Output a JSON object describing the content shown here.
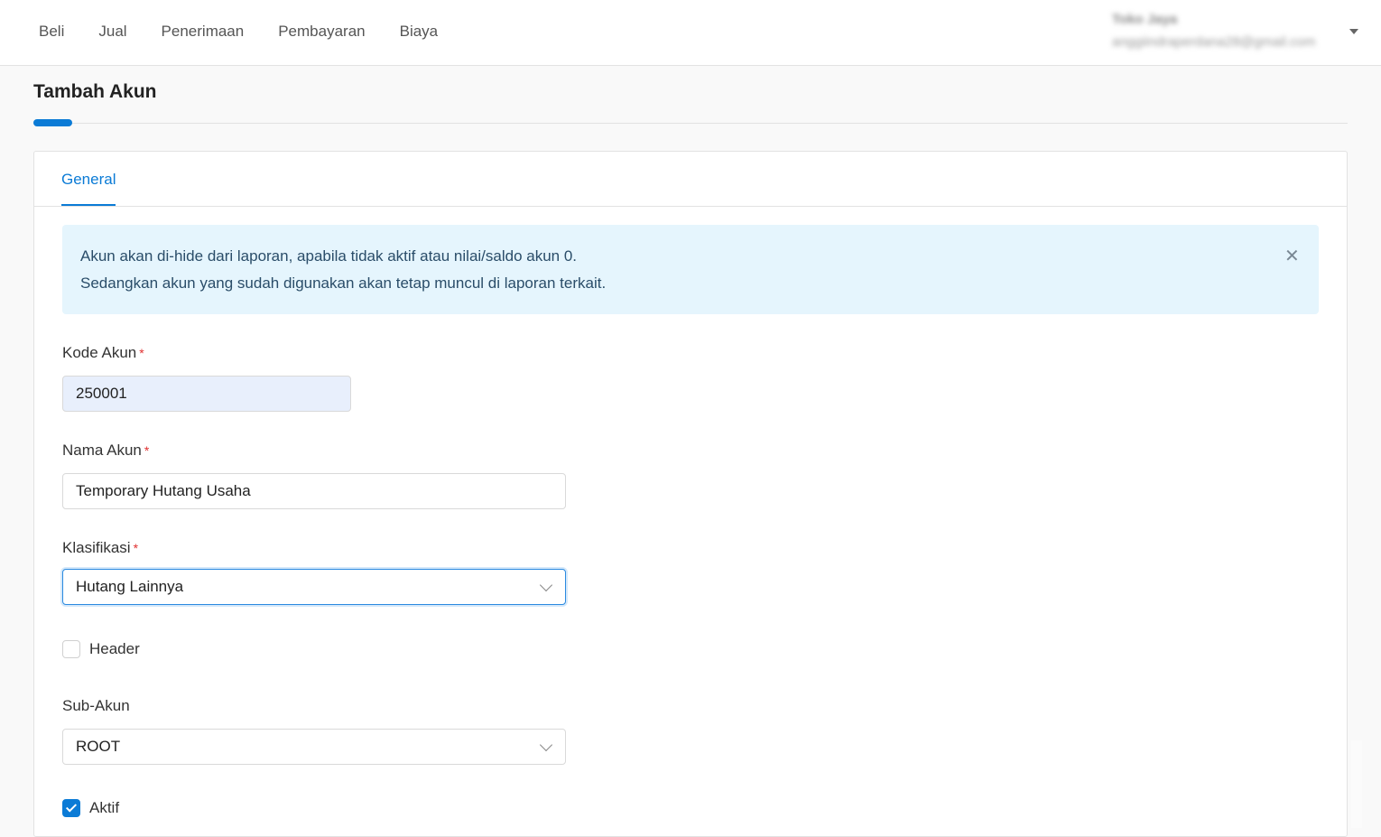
{
  "nav": {
    "items": [
      "Beli",
      "Jual",
      "Penerimaan",
      "Pembayaran",
      "Biaya"
    ]
  },
  "user": {
    "name": "Toko Jaya",
    "email": "anggiindraperdana28@gmail.com"
  },
  "page": {
    "title": "Tambah Akun"
  },
  "tabs": {
    "general": "General"
  },
  "alert": {
    "line1": "Akun akan di-hide dari laporan, apabila tidak aktif atau nilai/saldo akun 0.",
    "line2": "Sedangkan akun yang sudah digunakan akan tetap muncul di laporan terkait.",
    "close_icon": "close-icon"
  },
  "form": {
    "required_mark": "*",
    "kode_akun": {
      "label": "Kode Akun",
      "value": "250001"
    },
    "nama_akun": {
      "label": "Nama Akun",
      "value": "Temporary Hutang Usaha"
    },
    "klasifikasi": {
      "label": "Klasifikasi",
      "value": "Hutang Lainnya"
    },
    "header": {
      "label": "Header",
      "checked": false
    },
    "sub_akun": {
      "label": "Sub-Akun",
      "value": "ROOT"
    },
    "aktif": {
      "label": "Aktif",
      "checked": true
    }
  },
  "colors": {
    "accent": "#0b7bd6",
    "alert_bg": "#e5f5fd",
    "required": "#e03131"
  }
}
